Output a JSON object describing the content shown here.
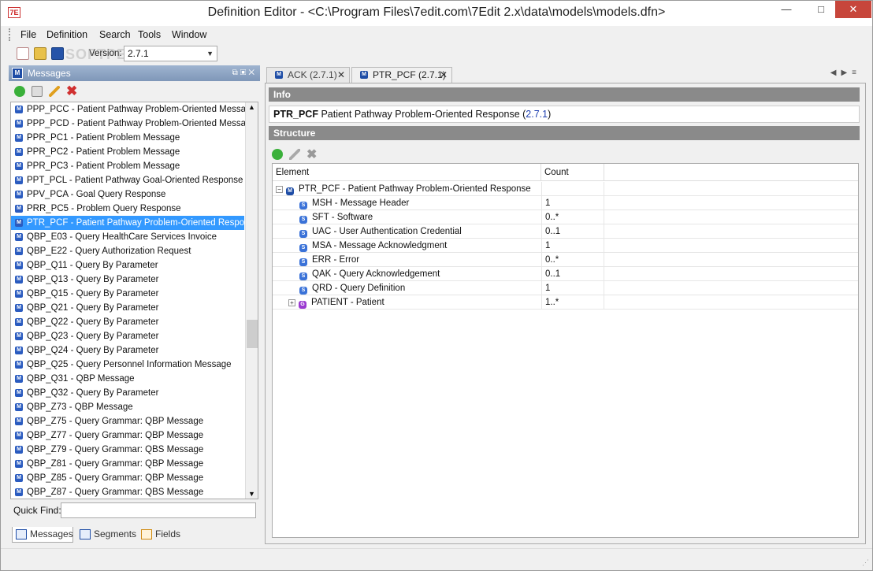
{
  "window": {
    "title": "Definition Editor - <C:\\Program Files\\7edit.com\\7Edit 2.x\\data\\models\\models.dfn>",
    "app_icon": "7E"
  },
  "menu": [
    "File",
    "Definition",
    "Search",
    "Tools",
    "Window"
  ],
  "toolbar": {
    "version_label": "Version:",
    "version_value": "2.7.1"
  },
  "messages_panel": {
    "title": "Messages",
    "items": [
      "PPP_PCC - Patient Pathway Problem-Oriented Message",
      "PPP_PCD - Patient Pathway Problem-Oriented Message",
      "PPR_PC1 - Patient Problem Message",
      "PPR_PC2 - Patient Problem Message",
      "PPR_PC3 - Patient Problem Message",
      "PPT_PCL - Patient Pathway Goal-Oriented Response",
      "PPV_PCA - Goal Query Response",
      "PRR_PC5 - Problem Query Response",
      "PTR_PCF - Patient Pathway Problem-Oriented Response",
      "QBP_E03 - Query HealthCare Services Invoice",
      "QBP_E22 - Query Authorization Request",
      "QBP_Q11 - Query By Parameter",
      "QBP_Q13 - Query By Parameter",
      "QBP_Q15 - Query By Parameter",
      "QBP_Q21 - Query By Parameter",
      "QBP_Q22 - Query By Parameter",
      "QBP_Q23 - Query By Parameter",
      "QBP_Q24 - Query By Parameter",
      "QBP_Q25 - Query Personnel Information Message",
      "QBP_Q31 - QBP Message",
      "QBP_Q32 - Query By Parameter",
      "QBP_Z73 - QBP Message",
      "QBP_Z75 - Query Grammar:  QBP Message",
      "QBP_Z77 - Query Grammar:  QBP Message",
      "QBP_Z79 - Query Grammar:  QBS Message",
      "QBP_Z81 - Query Grammar:  QBP Message",
      "QBP_Z85 - Query Grammar:  QBP Message",
      "QBP_Z87 - Query Grammar:  QBS Message"
    ],
    "selected_index": 8,
    "quick_find_label": "Quick Find:",
    "quick_find_value": "",
    "bottom_tabs": [
      "Messages",
      "Segments",
      "Fields"
    ]
  },
  "tabs": [
    {
      "label": "ACK (2.7.1)",
      "active": false
    },
    {
      "label": "PTR_PCF (2.7.1)",
      "active": true
    }
  ],
  "info": {
    "header": "Info",
    "code": "PTR_PCF",
    "description": "Patient Pathway Problem-Oriented Response (",
    "version": "2.7.1",
    "close_paren": ")"
  },
  "structure": {
    "header": "Structure",
    "columns": [
      "Element",
      "Count"
    ],
    "root": "PTR_PCF - Patient Pathway Problem-Oriented Response",
    "rows": [
      {
        "element": "MSH - Message Header",
        "count": "1"
      },
      {
        "element": "SFT - Software",
        "count": "0..*"
      },
      {
        "element": "UAC - User Authentication Credential",
        "count": "0..1"
      },
      {
        "element": "MSA - Message Acknowledgment",
        "count": "1"
      },
      {
        "element": "ERR - Error",
        "count": "0..*"
      },
      {
        "element": "QAK - Query Acknowledgement",
        "count": "0..1"
      },
      {
        "element": "QRD - Query Definition",
        "count": "1"
      },
      {
        "element": "PATIENT - Patient",
        "count": "1..*"
      }
    ]
  },
  "watermark": "SOFTPEDIA"
}
